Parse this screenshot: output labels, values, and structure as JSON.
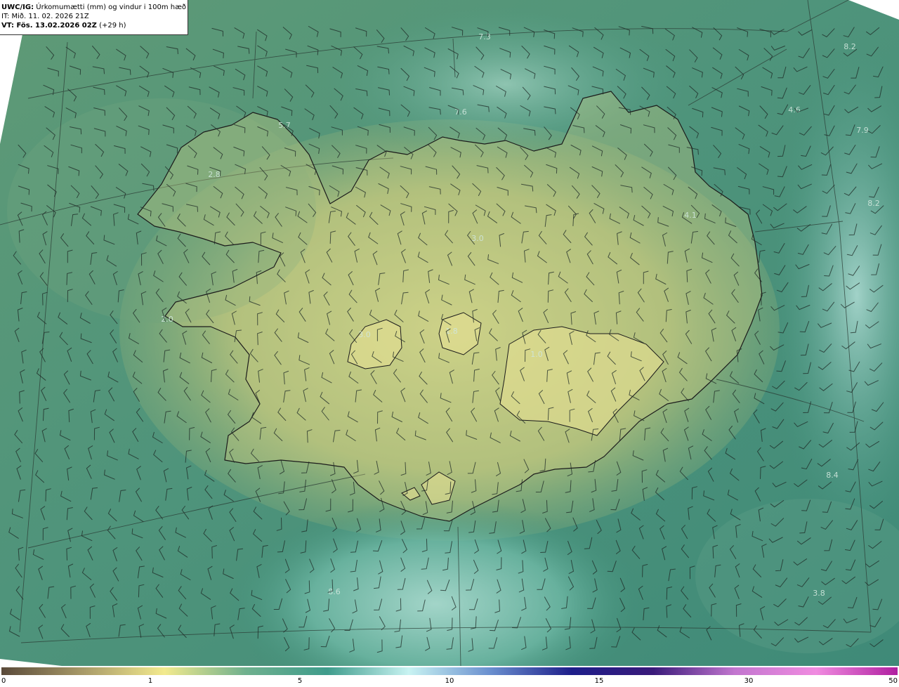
{
  "header": {
    "product_code": "UWC/IG:",
    "product_title": "Úrkomumætti (mm) og vindur i 100m hæð",
    "issue_time": "IT: Mið. 11. 02. 2026 21Z",
    "valid_prefix": "VT: Fös. 13.02.2026 02Z",
    "valid_suffix": "(+29 h)"
  },
  "map": {
    "region": "Iceland",
    "field": "precipitable water",
    "wind_level": "100m",
    "value_labels": [
      "7.3",
      "8.2",
      "5.7",
      "4.6",
      "7.6",
      "7.9",
      "2.8",
      "4.1",
      "3.0",
      "8.2",
      "2.0",
      "1.0",
      "1.8",
      "3.0",
      "8.4",
      "8.6",
      "3.8"
    ],
    "colors": {
      "coastline": "#1b1b1b",
      "graticule": "#2a3a33",
      "barb": "#1e2a25",
      "value_label": "#cfe6dc",
      "sea_base": "#3f8f7a",
      "land_dry": "#d9dc86"
    }
  },
  "colorbar": {
    "ticks": [
      "0",
      "1",
      "5",
      "10",
      "15",
      "30",
      "50"
    ],
    "stops": [
      "#5a4a3a",
      "#a89a68",
      "#f3ea8e",
      "#6fb08e",
      "#3f9c8c",
      "#c8f3f2",
      "#6a8fcf",
      "#1e1e8a",
      "#3a1a7a",
      "#c276cf",
      "#f08be0",
      "#b01fa0"
    ]
  }
}
